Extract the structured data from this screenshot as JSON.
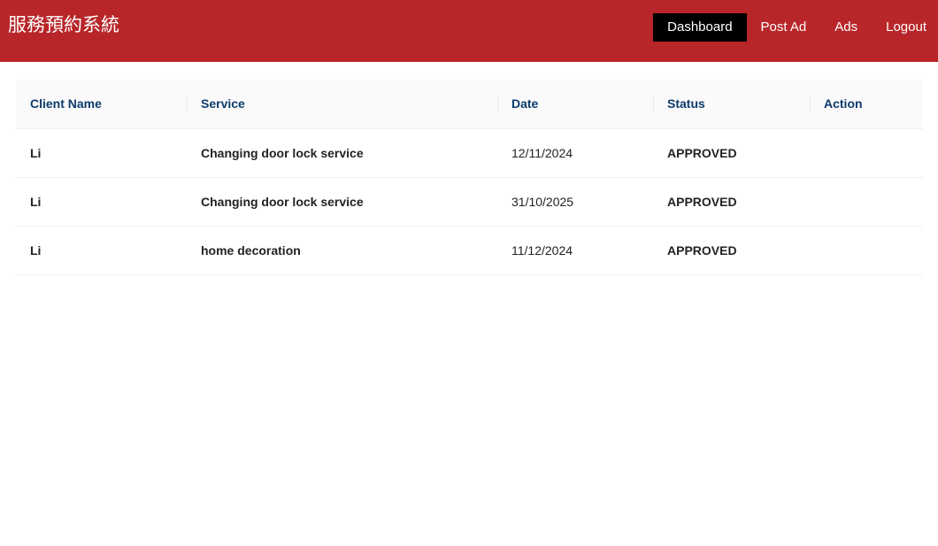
{
  "navbar": {
    "brand": "服務預約系統",
    "items": [
      {
        "label": "Dashboard",
        "active": true
      },
      {
        "label": "Post Ad",
        "active": false
      },
      {
        "label": "Ads",
        "active": false
      },
      {
        "label": "Logout",
        "active": false
      }
    ]
  },
  "colors": {
    "navbar_bg": "#b92629",
    "active_item_bg": "#000000",
    "header_text": "#0c3b6b"
  },
  "table": {
    "columns": [
      "Client Name",
      "Service",
      "Date",
      "Status",
      "Action"
    ],
    "rows": [
      {
        "client": "Li",
        "service": "Changing door lock service",
        "date": "12/11/2024",
        "status": "APPROVED",
        "action": ""
      },
      {
        "client": "Li",
        "service": "Changing door lock service",
        "date": "31/10/2025",
        "status": "APPROVED",
        "action": ""
      },
      {
        "client": "Li",
        "service": "home decoration",
        "date": "11/12/2024",
        "status": "APPROVED",
        "action": ""
      }
    ]
  }
}
